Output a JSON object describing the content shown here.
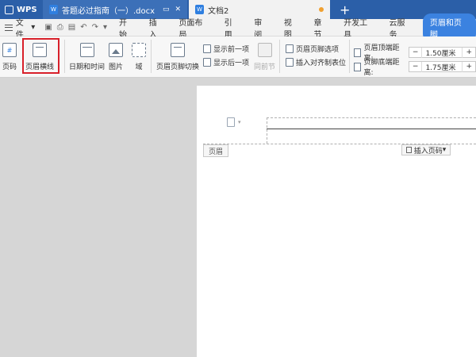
{
  "titlebar": {
    "app_label": "WPS",
    "tabs": [
      {
        "label": "答题必过指南（一）.docx",
        "state": "inactive"
      },
      {
        "label": "文档2",
        "state": "active"
      }
    ],
    "new_tab": "+"
  },
  "menubar": {
    "file_label": "文件",
    "file_arrow": "▾",
    "tabs": [
      "开始",
      "插入",
      "页面布局",
      "引用",
      "审阅",
      "视图",
      "章节",
      "开发工具",
      "云服务",
      "页眉和页脚"
    ],
    "active_tab": "页眉和页脚"
  },
  "ribbon": {
    "page_number": "页码",
    "header_line": "页眉横线",
    "date_time": "日期和时间",
    "picture": "图片",
    "field": "域",
    "header_footer_switch": "页眉页脚切换",
    "show_previous": "显示前一项",
    "show_next": "显示后一项",
    "same_as_previous": "同前节",
    "hf_options": "页眉页脚选项",
    "insert_align_tab": "插入对齐制表位",
    "header_top_distance": {
      "label": "页眉顶端距离:",
      "value": "1.50厘米"
    },
    "footer_bottom_distance": {
      "label": "页脚底端距离:",
      "value": "1.75厘米"
    },
    "minus": "−",
    "plus": "+"
  },
  "document": {
    "header_tag": "页眉",
    "insert_page_number": "插入页码"
  },
  "colors": {
    "titlebar_bg": "#2b5fa8",
    "accent": "#3b82e0",
    "highlight_box": "#d8202a",
    "workspace_bg": "#d6d6d6"
  }
}
